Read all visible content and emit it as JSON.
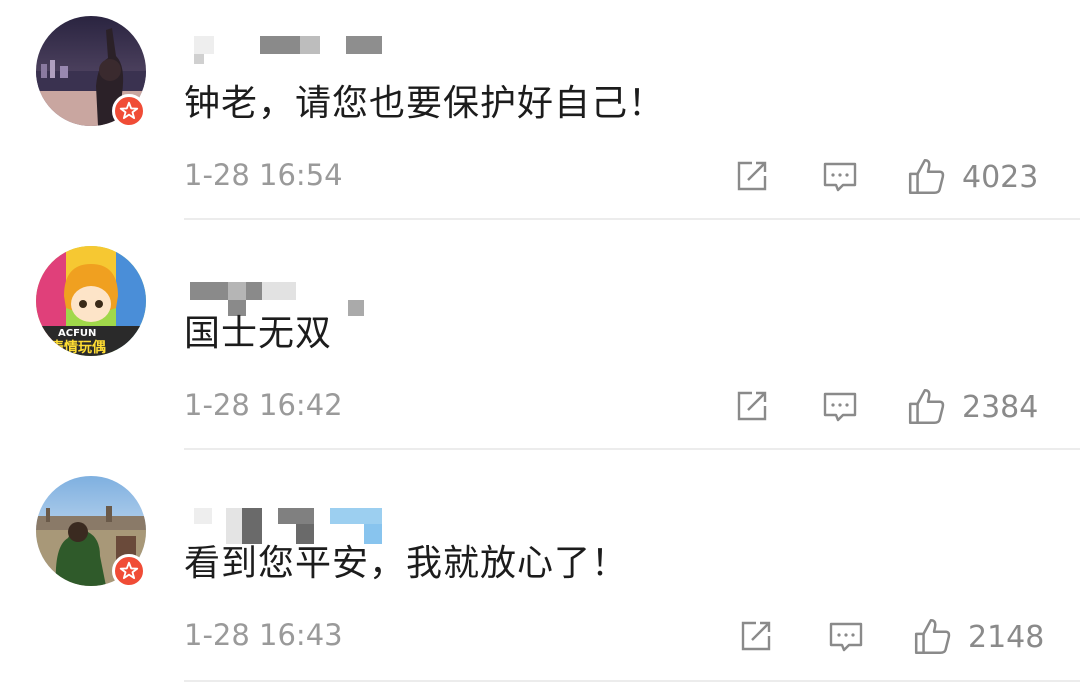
{
  "comments": [
    {
      "text": "钟老，请您也要保护好自己！",
      "time": "1-28 16:54",
      "likes": "4023",
      "avatar": "avatar-night-city",
      "verified": true
    },
    {
      "text": "国士无双",
      "time": "1-28 16:42",
      "likes": "2384",
      "avatar": "avatar-acfun-cartoon",
      "avatar_text": [
        "ACFUN",
        "表情玩偶"
      ],
      "verified": false
    },
    {
      "text": "看到您平安，我就放心了！",
      "time": "1-28 16:43",
      "likes": "2148",
      "avatar": "avatar-outdoor-person",
      "verified": true
    }
  ],
  "icons": {
    "share": "share-icon",
    "reply": "comment-icon",
    "like": "thumbs-up-icon",
    "badge": "verified-star-icon"
  },
  "colors": {
    "badge": "#f04c36",
    "text": "#1c1c1c",
    "meta": "#9a9a9a"
  }
}
